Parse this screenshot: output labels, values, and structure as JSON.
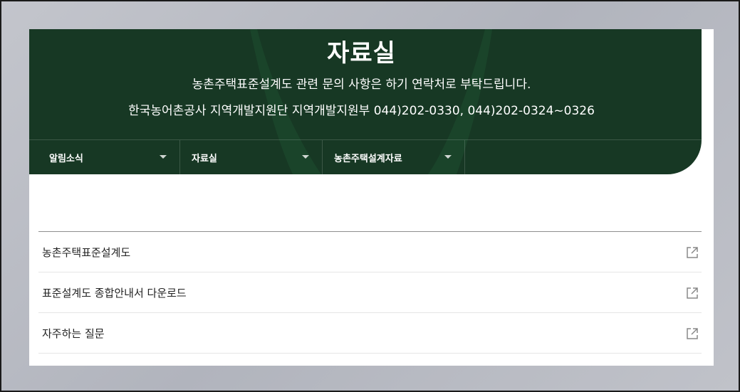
{
  "hero": {
    "title": "자료실",
    "line1": "농촌주택표준설계도 관련 문의 사항은 하기 연락처로 부탁드립니다.",
    "line2": "한국농어촌공사 지역개발지원단 지역개발지원부 044)202-0330, 044)202-0324~0326"
  },
  "nav": {
    "items": [
      {
        "label": "알림소식"
      },
      {
        "label": "자료실"
      },
      {
        "label": "농촌주택설계자료"
      }
    ]
  },
  "list": {
    "items": [
      {
        "label": "농촌주택표준설계도",
        "icon": "external-link-icon"
      },
      {
        "label": "표준설계도 종합안내서 다운로드",
        "icon": "external-link-icon"
      },
      {
        "label": "자주하는 질문",
        "icon": "external-link-icon"
      }
    ]
  },
  "colors": {
    "hero_bg": "#173824",
    "text": "#222222",
    "divider": "#8f8f8f"
  }
}
